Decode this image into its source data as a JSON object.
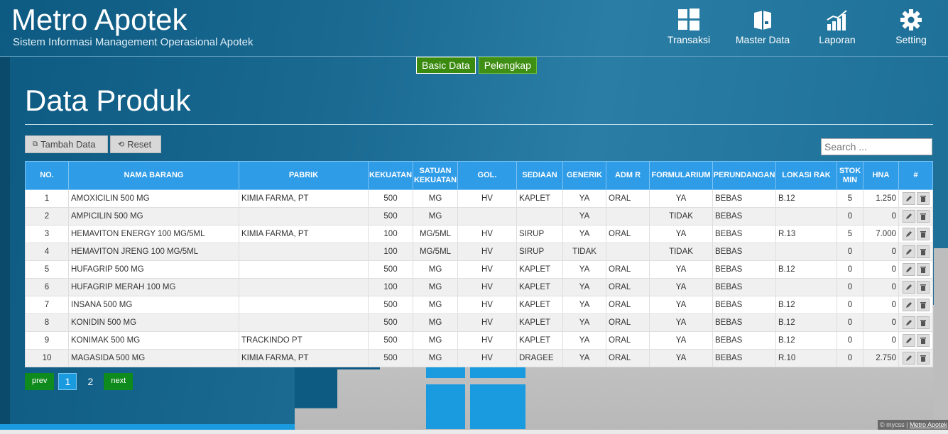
{
  "brand": {
    "title": "Metro Apotek",
    "subtitle": "Sistem Informasi Management Operasional Apotek"
  },
  "nav": {
    "transaksi": "Transaksi",
    "master": "Master Data",
    "laporan": "Laporan",
    "setting": "Setting"
  },
  "tabs": {
    "basic": "Basic Data",
    "pelengkap": "Pelengkap"
  },
  "page_title": "Data Produk",
  "toolbar": {
    "add": "Tambah Data",
    "reset": "Reset",
    "search_placeholder": "Search ..."
  },
  "table": {
    "headers": [
      "NO.",
      "NAMA BARANG",
      "PABRIK",
      "KEKUATAN",
      "SATUAN KEKUATAN",
      "GOL.",
      "SEDIAAN",
      "GENERIK",
      "ADM R",
      "FORMULARIUM",
      "PERUNDANGAN",
      "LOKASI RAK",
      "STOK MIN",
      "HNA",
      "#"
    ],
    "rows": [
      [
        "1",
        "AMOXICILIN 500 MG",
        "KIMIA FARMA, PT",
        "500",
        "MG",
        "HV",
        "KAPLET",
        "YA",
        "ORAL",
        "YA",
        "BEBAS",
        "B.12",
        "5",
        "1.250"
      ],
      [
        "2",
        "AMPICILIN 500 MG",
        "",
        "500",
        "MG",
        "",
        "",
        "YA",
        "",
        "TIDAK",
        "BEBAS",
        "",
        "0",
        "0"
      ],
      [
        "3",
        "HEMAVITON ENERGY 100 MG/5ML",
        "KIMIA FARMA, PT",
        "100",
        "MG/5ML",
        "HV",
        "SIRUP",
        "YA",
        "ORAL",
        "YA",
        "BEBAS",
        "R.13",
        "5",
        "7.000"
      ],
      [
        "4",
        "HEMAVITON JRENG 100 MG/5ML",
        "",
        "100",
        "MG/5ML",
        "HV",
        "SIRUP",
        "TIDAK",
        "",
        "TIDAK",
        "BEBAS",
        "",
        "0",
        "0"
      ],
      [
        "5",
        "HUFAGRIP 500 MG",
        "",
        "500",
        "MG",
        "HV",
        "KAPLET",
        "YA",
        "ORAL",
        "YA",
        "BEBAS",
        "B.12",
        "0",
        "0"
      ],
      [
        "6",
        "HUFAGRIP MERAH 100 MG",
        "",
        "100",
        "MG",
        "HV",
        "KAPLET",
        "YA",
        "ORAL",
        "YA",
        "BEBAS",
        "",
        "0",
        "0"
      ],
      [
        "7",
        "INSANA 500 MG",
        "",
        "500",
        "MG",
        "HV",
        "KAPLET",
        "YA",
        "ORAL",
        "YA",
        "BEBAS",
        "B.12",
        "0",
        "0"
      ],
      [
        "8",
        "KONIDIN 500 MG",
        "",
        "500",
        "MG",
        "HV",
        "KAPLET",
        "YA",
        "ORAL",
        "YA",
        "BEBAS",
        "B.12",
        "0",
        "0"
      ],
      [
        "9",
        "KONIMAK 500 MG",
        "TRACKINDO PT",
        "500",
        "MG",
        "HV",
        "KAPLET",
        "YA",
        "ORAL",
        "YA",
        "BEBAS",
        "B.12",
        "0",
        "0"
      ],
      [
        "10",
        "MAGASIDA 500 MG",
        "KIMIA FARMA, PT",
        "500",
        "MG",
        "HV",
        "DRAGEE",
        "YA",
        "ORAL",
        "YA",
        "BEBAS",
        "R.10",
        "0",
        "2.750"
      ]
    ]
  },
  "pager": {
    "prev": "prev",
    "next": "next",
    "pages": [
      "1",
      "2"
    ]
  },
  "footer": {
    "copy": "© mycss |",
    "link": "Metro Apotek"
  }
}
